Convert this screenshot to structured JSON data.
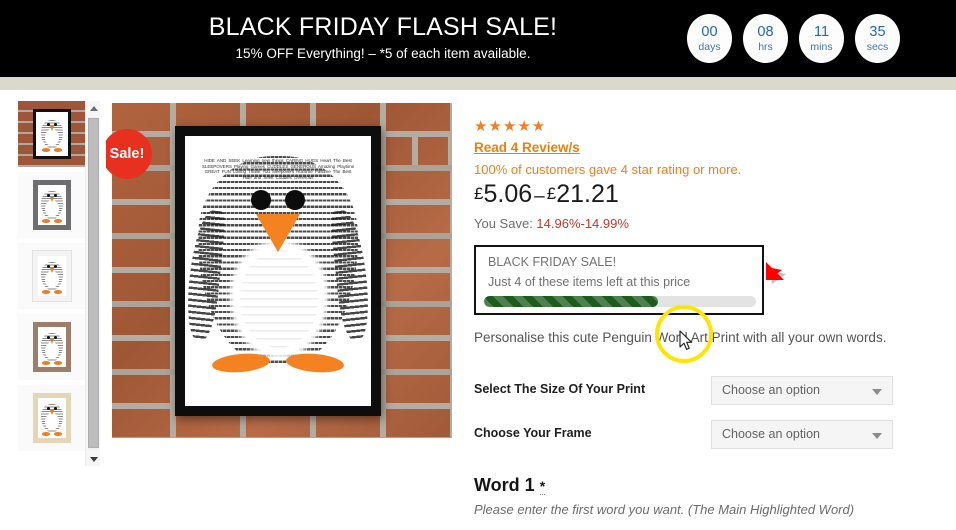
{
  "promo": {
    "title": "BLACK FRIDAY FLASH SALE!",
    "subtitle": "15% OFF Everything! – *5 of each item available.",
    "timer": [
      {
        "value": "00",
        "label": "days"
      },
      {
        "value": "08",
        "label": "hrs"
      },
      {
        "value": "11",
        "label": "mins"
      },
      {
        "value": "35",
        "label": "secs"
      }
    ]
  },
  "gallery": {
    "sale_badge": "Sale!",
    "thumbnails": [
      {
        "name": "thumbnail-black-frame-brick",
        "frame": "black"
      },
      {
        "name": "thumbnail-grey-frame",
        "frame": "grey"
      },
      {
        "name": "thumbnail-white-frame",
        "frame": "white"
      },
      {
        "name": "thumbnail-brown-frame",
        "frame": "brown"
      },
      {
        "name": "thumbnail-cream-frame",
        "frame": "cream"
      }
    ],
    "scroll_up_icon": "triangle-up-icon",
    "scroll_down_icon": "triangle-down-icon",
    "wordcloud_words": "HIDE AND SEEK Learning new things CARING HUGS Heart The Best SLEEPOVERS Playing Games CUDDLES GENEROUS Amazing Playtime GREAT FUN Loving Thank You Sleepovers Runtime Pastime The Best Hide and Seek Cuddles Generous"
  },
  "product": {
    "stars": "★★★★★",
    "review_link": "Read 4 Review/s",
    "review_percent": "100% of customers gave 4 star rating or more.",
    "price_min_currency": "£",
    "price_min": "5.06",
    "price_dash": "–",
    "price_max_currency": "£",
    "price_max": "21.21",
    "save_label": "You Save: ",
    "save_value": "14.96%-14.99%",
    "sale_box": {
      "title": "BLACK FRIDAY SALE!",
      "subtitle": "Just 4 of these items left at this price",
      "progress_percent": 64,
      "fill_color": "#1e5c1e"
    },
    "description": "Personalise this cute Penguin Word Art Print with all your own words.",
    "options": [
      {
        "label": "Select The Size Of Your Print",
        "value": "Choose an option",
        "caret": "chevron-down-icon"
      },
      {
        "label": "Choose Your Frame",
        "value": "Choose an option",
        "caret": "chevron-down-icon"
      }
    ],
    "word_field": {
      "heading": "Word 1",
      "required_marker": "*",
      "hint": "Please enter the first word you want. (The Main Highlighted Word)"
    }
  },
  "annotations": {
    "arrow_color": "#ff0000",
    "highlight_color": "#ffe500",
    "cursor_icon": "mouse-pointer-icon"
  },
  "colors": {
    "promo_bg": "#000000",
    "beige_strip": "#dbd9cc",
    "accent_orange": "#f57c20",
    "sale_red": "#e8301e",
    "timer_text": "#2266bb",
    "save_red": "#c0392b"
  }
}
